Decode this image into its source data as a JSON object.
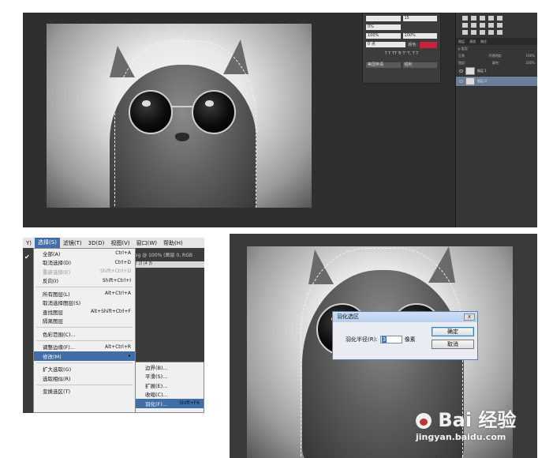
{
  "panel1": {
    "properties": {
      "size_value": "15",
      "percent_a": "0%",
      "percent_b": "100%",
      "percent_c": "100%",
      "point_value": "0 点",
      "color_label": "颜色:",
      "text_style_row": "T T TT Tr T' T, T T",
      "antialias_a": "美国英语",
      "antialias_b": "锐利",
      "accent_color": "#cc1f3c"
    },
    "layers": {
      "tabs": [
        "图层",
        "通道",
        "路径"
      ],
      "kind_label": "ρ 类型",
      "blend_mode": "正常",
      "opacity_label": "不透明度:",
      "opacity_value": "100%",
      "lock_label": "锁定:",
      "fill_label": "填充:",
      "fill_value": "100%",
      "rows": [
        {
          "name": "图层 1"
        },
        {
          "name": "图层 0"
        }
      ]
    }
  },
  "panel2": {
    "menubar": [
      "Y)",
      "选择(S)",
      "滤镜(T)",
      "3D(D)",
      "视图(V)",
      "窗口(W)",
      "帮助(H)"
    ],
    "doc_tab": "jpg @ 100% (图层 0, RGB",
    "ruler": "|2    |3    |4    |5",
    "menu_items": [
      {
        "label": "全部(A)",
        "shortcut": "Ctrl+A"
      },
      {
        "label": "取消选择(D)",
        "shortcut": "Ctrl+D"
      },
      {
        "label": "重新选择(E)",
        "shortcut": "Shift+Ctrl+D",
        "disabled": true
      },
      {
        "label": "反向(I)",
        "shortcut": "Shift+Ctrl+I"
      },
      {
        "sep": true
      },
      {
        "label": "所有图层(L)",
        "shortcut": "Alt+Ctrl+A"
      },
      {
        "label": "取消选择图层(S)",
        "shortcut": ""
      },
      {
        "label": "查找图层",
        "shortcut": "Alt+Shift+Ctrl+F"
      },
      {
        "label": "隔离图层",
        "shortcut": ""
      },
      {
        "sep": true
      },
      {
        "label": "色彩范围(C)...",
        "shortcut": ""
      },
      {
        "sep": true
      },
      {
        "label": "调整边缘(F)...",
        "shortcut": "Alt+Ctrl+R"
      },
      {
        "label": "修改(M)",
        "shortcut": "▸",
        "highlight": true
      },
      {
        "sep": true
      },
      {
        "label": "扩大选取(G)",
        "shortcut": ""
      },
      {
        "label": "选取相似(R)",
        "shortcut": ""
      },
      {
        "sep": true
      },
      {
        "label": "变换选区(T)",
        "shortcut": ""
      }
    ],
    "submenu_items": [
      {
        "label": "边界(B)...",
        "shortcut": ""
      },
      {
        "label": "平滑(S)...",
        "shortcut": ""
      },
      {
        "label": "扩展(E)...",
        "shortcut": ""
      },
      {
        "label": "收缩(C)...",
        "shortcut": ""
      },
      {
        "label": "羽化(F)...",
        "shortcut": "Shift+F6",
        "highlight": true
      }
    ]
  },
  "panel3": {
    "dialog_title": "羽化选区",
    "radius_label": "羽化半径(R):",
    "radius_value": "3",
    "unit": "像素",
    "ok_label": "确定",
    "cancel_label": "取消",
    "close_label": "x"
  },
  "watermark": {
    "logo": "Bai 经验",
    "url": "jingyan.baidu.com"
  }
}
